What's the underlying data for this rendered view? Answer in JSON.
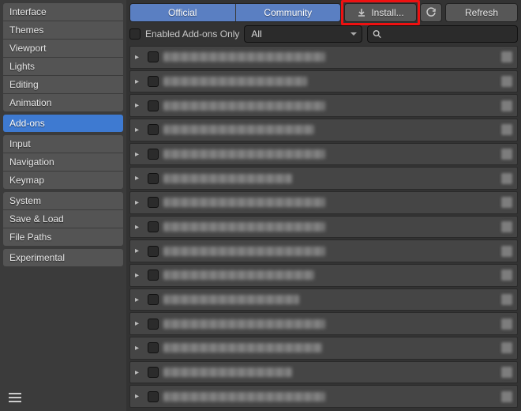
{
  "sidebar": {
    "groups": [
      [
        "Interface",
        "Themes",
        "Viewport",
        "Lights",
        "Editing",
        "Animation"
      ],
      [
        "Add-ons"
      ],
      [
        "Input",
        "Navigation",
        "Keymap"
      ],
      [
        "System",
        "Save & Load",
        "File Paths"
      ],
      [
        "Experimental"
      ]
    ],
    "active": "Add-ons"
  },
  "toolbar": {
    "seg": {
      "official": "Official",
      "community": "Community"
    },
    "install": "Install...",
    "refresh": "Refresh"
  },
  "filters": {
    "enabled_only_label": "Enabled Add-ons Only",
    "enabled_only_checked": false,
    "category": "All",
    "search_placeholder": ""
  },
  "addons": {
    "rows": 15,
    "widths_pct": [
      62,
      38,
      52,
      40,
      58,
      34,
      50,
      44,
      46,
      40,
      36,
      45,
      42,
      34,
      48
    ]
  }
}
